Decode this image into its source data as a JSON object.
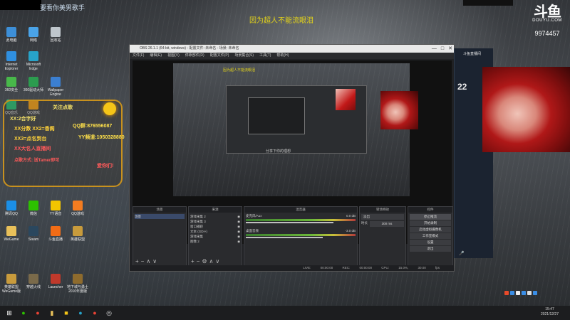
{
  "desktop": {
    "icons": [
      {
        "label": "此电脑",
        "color": "#3d8fd8",
        "col": 0,
        "row": 0
      },
      {
        "label": "网络",
        "color": "#4aa3e8",
        "col": 1,
        "row": 0
      },
      {
        "label": "回收站",
        "color": "#bfc6cc",
        "col": 2,
        "row": 0
      },
      {
        "label": "Internet Explorer",
        "color": "#2f8fe0",
        "col": 0,
        "row": 1
      },
      {
        "label": "Microsoft Edge",
        "color": "#27a3c9",
        "col": 1,
        "row": 1
      },
      {
        "label": "360安全",
        "color": "#48b84a",
        "col": 0,
        "row": 2
      },
      {
        "label": "360驱动大师",
        "color": "#2c9c4f",
        "col": 1,
        "row": 2
      },
      {
        "label": "Wallpaper Engine",
        "color": "#3b7fd1",
        "col": 2,
        "row": 2
      },
      {
        "label": "QQ音乐",
        "color": "#31c27c",
        "col": 0,
        "row": 3
      },
      {
        "label": "QQ游戏",
        "color": "#f5a623",
        "col": 1,
        "row": 3
      },
      {
        "label": "腾讯QQ",
        "color": "#1b8fe6",
        "col": 0,
        "row": 7
      },
      {
        "label": "微信",
        "color": "#2dc100",
        "col": 1,
        "row": 7
      },
      {
        "label": "YY语音",
        "color": "#f2c500",
        "col": 2,
        "row": 7
      },
      {
        "label": "QQ游戏",
        "color": "#f47c20",
        "col": 3,
        "row": 7
      },
      {
        "label": "WeGame",
        "color": "#e8c05a",
        "col": 0,
        "row": 8
      },
      {
        "label": "Steam",
        "color": "#2a475e",
        "col": 1,
        "row": 8
      },
      {
        "label": "斗鱼直播",
        "color": "#f26c16",
        "col": 2,
        "row": 8
      },
      {
        "label": "英雄联盟",
        "color": "#c89b3c",
        "col": 3,
        "row": 8
      },
      {
        "label": "英雄联盟 WeGame版",
        "color": "#c89b3c",
        "col": 0,
        "row": 10
      },
      {
        "label": "穿越火线",
        "color": "#7a6a4a",
        "col": 1,
        "row": 10
      },
      {
        "label": "Launcher",
        "color": "#c0392b",
        "col": 2,
        "row": 10
      },
      {
        "label": "地下城与勇士 2010年度版",
        "color": "#8e6b2d",
        "col": 3,
        "row": 10
      }
    ]
  },
  "stream_overlay": {
    "top_banner": "要看你美男歌手",
    "caption": "因为超人不能流眼泪",
    "platform_logo": "斗鱼",
    "platform_domain": "DOUYU.COM",
    "room_id": "9974457"
  },
  "gold_panel": {
    "lines": [
      {
        "text": "XX:2合字好",
        "color": "#f5e26a"
      },
      {
        "text": "XX分数 XX2=香阁",
        "color": "#ffd23a"
      },
      {
        "text": "QQ群:876556087",
        "color": "#ffe14a"
      },
      {
        "text": "XX3=点名到台",
        "color": "#ffd23a"
      },
      {
        "text": "YY频道:1050328880",
        "color": "#ffe14a"
      },
      {
        "text": "XX大名人直播间",
        "color": "#ff5a5a"
      },
      {
        "text": "点歌方式: 送Tamer即可",
        "color": "#ff5a5a"
      },
      {
        "text": "爱你们!",
        "color": "#ff5a5a"
      },
      {
        "text": "关注点歌",
        "color": "#f5e26a"
      }
    ]
  },
  "obs": {
    "title": "OBS 26.1.1 (64-bit, windows) - 配置文件: 未命名 - 场景: 未命名",
    "window_controls": [
      "—",
      "□",
      "✕"
    ],
    "menu": [
      "文件(F)",
      "编辑(E)",
      "视图(V)",
      "停靠部件(D)",
      "配置文件(P)",
      "场景集合(S)",
      "工具(T)",
      "帮助(H)"
    ],
    "preview_caption": "因为超人不能流眼泪",
    "inner_caption": "分享下你的理想",
    "docks": {
      "scenes": {
        "title": "场景",
        "items": [
          "场景"
        ]
      },
      "sources": {
        "title": "来源",
        "items": [
          "游戏采集 2",
          "游戏采集 3",
          "窗口捕获",
          "文本 (GDI+)",
          "游戏采集",
          "图像 2"
        ]
      },
      "mixer": {
        "title": "混音器",
        "channels": [
          {
            "name": "麦克风/Aux",
            "db": "0.0 dB"
          },
          {
            "name": "桌面音频",
            "db": "-3.0 dB"
          }
        ]
      },
      "transitions": {
        "title": "转场特效",
        "type": "淡出",
        "duration_label": "时长",
        "duration": "300 ms"
      },
      "controls": {
        "title": "控件",
        "buttons": [
          "停止推流",
          "开始录制",
          "启动虚拟摄像机",
          "工作室模式",
          "设置",
          "退出"
        ]
      }
    },
    "status": "LIVE: 00:00:00 REC: 00:00:00 CPU: 15.0%, 30.00 fps"
  },
  "chat": {
    "header": "斗鱼直播间",
    "count": "22"
  },
  "taskbar": {
    "time": "15:47",
    "date": "2021/12/27"
  }
}
